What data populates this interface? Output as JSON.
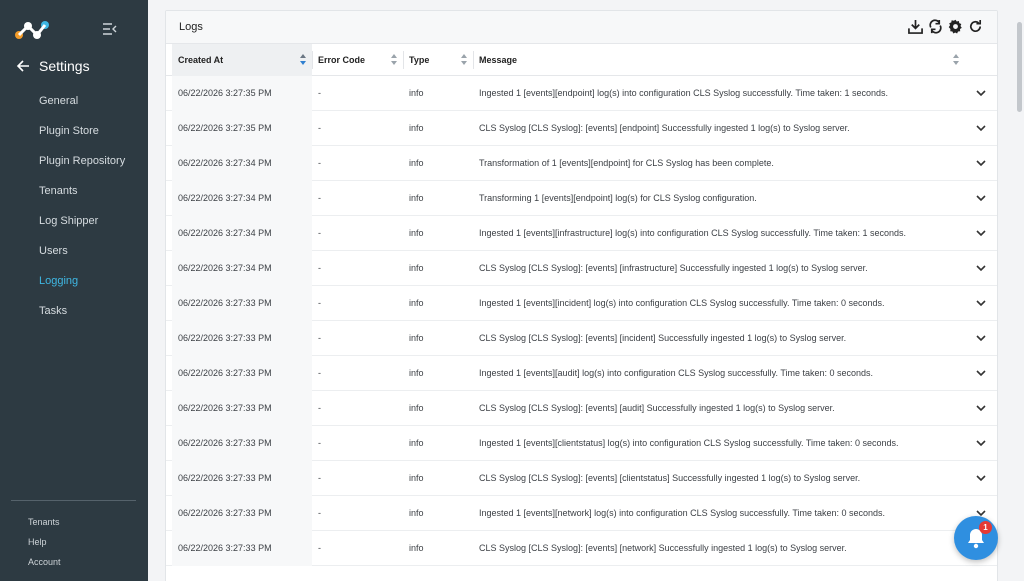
{
  "sidebar": {
    "title": "Settings",
    "items": [
      {
        "label": "General"
      },
      {
        "label": "Plugin Store"
      },
      {
        "label": "Plugin Repository"
      },
      {
        "label": "Tenants"
      },
      {
        "label": "Log Shipper"
      },
      {
        "label": "Users"
      },
      {
        "label": "Logging",
        "active": true
      },
      {
        "label": "Tasks"
      }
    ],
    "bottom": [
      {
        "label": "Tenants"
      },
      {
        "label": "Help"
      },
      {
        "label": "Account"
      }
    ]
  },
  "panel": {
    "title": "Logs",
    "toolbar_icons": [
      "download-icon",
      "sync-icon",
      "gear-icon",
      "refresh-icon"
    ]
  },
  "table": {
    "columns": [
      "Created At",
      "Error Code",
      "Type",
      "Message"
    ],
    "rows": [
      {
        "created": "06/22/2026 3:27:35 PM",
        "code": "-",
        "type": "info",
        "message": "Ingested 1 [events][endpoint] log(s) into configuration CLS Syslog successfully. Time taken: 1 seconds."
      },
      {
        "created": "06/22/2026 3:27:35 PM",
        "code": "-",
        "type": "info",
        "message": "CLS Syslog [CLS Syslog]: [events] [endpoint] Successfully ingested 1 log(s) to Syslog server."
      },
      {
        "created": "06/22/2026 3:27:34 PM",
        "code": "-",
        "type": "info",
        "message": "Transformation of 1 [events][endpoint] for CLS Syslog has been complete."
      },
      {
        "created": "06/22/2026 3:27:34 PM",
        "code": "-",
        "type": "info",
        "message": "Transforming 1 [events][endpoint] log(s) for CLS Syslog configuration."
      },
      {
        "created": "06/22/2026 3:27:34 PM",
        "code": "-",
        "type": "info",
        "message": "Ingested 1 [events][infrastructure] log(s) into configuration CLS Syslog successfully. Time taken: 1 seconds."
      },
      {
        "created": "06/22/2026 3:27:34 PM",
        "code": "-",
        "type": "info",
        "message": "CLS Syslog [CLS Syslog]: [events] [infrastructure] Successfully ingested 1 log(s) to Syslog server."
      },
      {
        "created": "06/22/2026 3:27:33 PM",
        "code": "-",
        "type": "info",
        "message": "Ingested 1 [events][incident] log(s) into configuration CLS Syslog successfully. Time taken: 0 seconds."
      },
      {
        "created": "06/22/2026 3:27:33 PM",
        "code": "-",
        "type": "info",
        "message": "CLS Syslog [CLS Syslog]: [events] [incident] Successfully ingested 1 log(s) to Syslog server."
      },
      {
        "created": "06/22/2026 3:27:33 PM",
        "code": "-",
        "type": "info",
        "message": "Ingested 1 [events][audit] log(s) into configuration CLS Syslog successfully. Time taken: 0 seconds."
      },
      {
        "created": "06/22/2026 3:27:33 PM",
        "code": "-",
        "type": "info",
        "message": "CLS Syslog [CLS Syslog]: [events] [audit] Successfully ingested 1 log(s) to Syslog server."
      },
      {
        "created": "06/22/2026 3:27:33 PM",
        "code": "-",
        "type": "info",
        "message": "Ingested 1 [events][clientstatus] log(s) into configuration CLS Syslog successfully. Time taken: 0 seconds."
      },
      {
        "created": "06/22/2026 3:27:33 PM",
        "code": "-",
        "type": "info",
        "message": "CLS Syslog [CLS Syslog]: [events] [clientstatus] Successfully ingested 1 log(s) to Syslog server."
      },
      {
        "created": "06/22/2026 3:27:33 PM",
        "code": "-",
        "type": "info",
        "message": "Ingested 1 [events][network] log(s) into configuration CLS Syslog successfully. Time taken: 0 seconds."
      },
      {
        "created": "06/22/2026 3:27:33 PM",
        "code": "-",
        "type": "info",
        "message": "CLS Syslog [CLS Syslog]: [events] [network] Successfully ingested 1 log(s) to Syslog server."
      }
    ]
  },
  "notification": {
    "count": "1"
  },
  "colors": {
    "sidebar_bg": "#2d3a42",
    "active": "#3fb7e3",
    "bell": "#2f8fe0",
    "badge": "#e53935"
  }
}
